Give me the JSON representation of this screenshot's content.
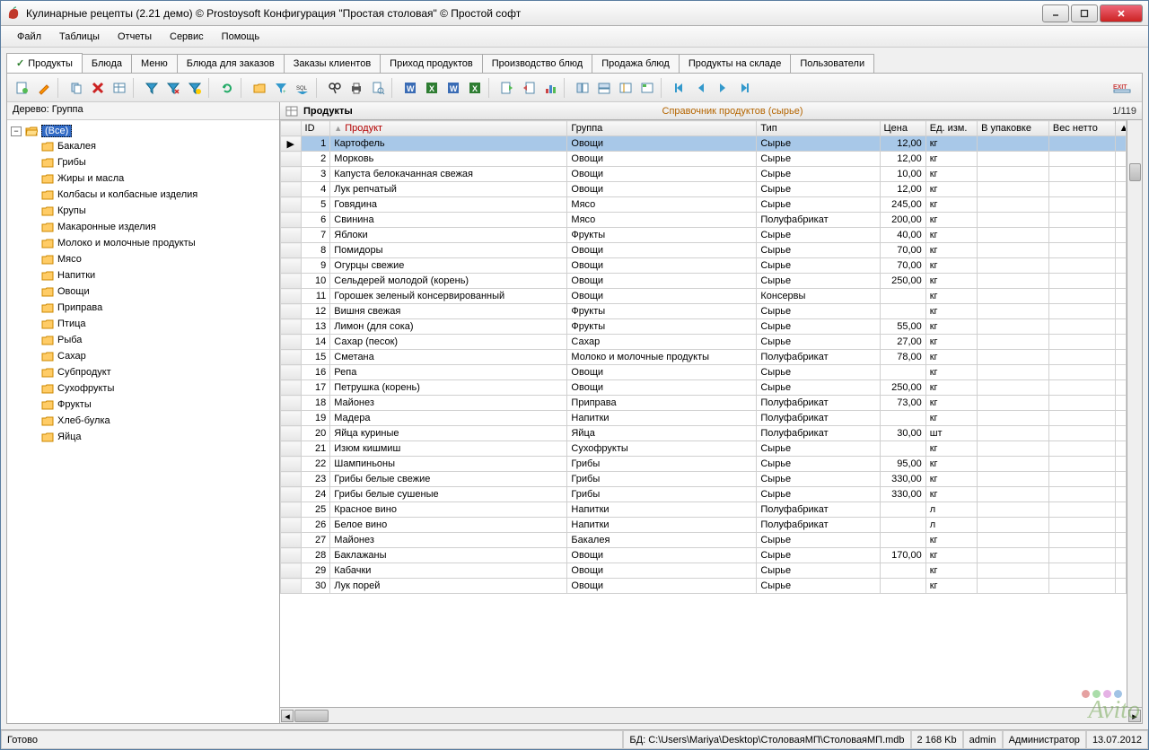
{
  "titlebar": "Кулинарные рецепты (2.21 демо) © Prostoysoft   Конфигурация \"Простая столовая\" © Простой софт",
  "menu": [
    "Файл",
    "Таблицы",
    "Отчеты",
    "Сервис",
    "Помощь"
  ],
  "tabs": [
    "Продукты",
    "Блюда",
    "Меню",
    "Блюда для заказов",
    "Заказы клиентов",
    "Приход продуктов",
    "Производство блюд",
    "Продажа блюд",
    "Продукты на складе",
    "Пользователи"
  ],
  "tree": {
    "header": "Дерево: Группа",
    "root": "(Все)",
    "items": [
      "Бакалея",
      "Грибы",
      "Жиры и масла",
      "Колбасы и колбасные изделия",
      "Крупы",
      "Макаронные изделия",
      "Молоко и молочные продукты",
      "Мясо",
      "Напитки",
      "Овощи",
      "Приправа",
      "Птица",
      "Рыба",
      "Сахар",
      "Субпродукт",
      "Сухофрукты",
      "Фрукты",
      "Хлеб-булка",
      "Яйца"
    ]
  },
  "gridheader": {
    "title": "Продукты",
    "subtitle": "Справочник продуктов (сырье)",
    "count": "1/119"
  },
  "columns": [
    "ID",
    "Продукт",
    "Группа",
    "Тип",
    "Цена",
    "Ед. изм.",
    "В упаковке",
    "Вес нетто"
  ],
  "rows": [
    {
      "id": 1,
      "prod": "Картофель",
      "group": "Овощи",
      "type": "Сырье",
      "price": "12,00",
      "unit": "кг"
    },
    {
      "id": 2,
      "prod": "Морковь",
      "group": "Овощи",
      "type": "Сырье",
      "price": "12,00",
      "unit": "кг"
    },
    {
      "id": 3,
      "prod": "Капуста белокачанная свежая",
      "group": "Овощи",
      "type": "Сырье",
      "price": "10,00",
      "unit": "кг"
    },
    {
      "id": 4,
      "prod": "Лук репчатый",
      "group": "Овощи",
      "type": "Сырье",
      "price": "12,00",
      "unit": "кг"
    },
    {
      "id": 5,
      "prod": "Говядина",
      "group": "Мясо",
      "type": "Сырье",
      "price": "245,00",
      "unit": "кг"
    },
    {
      "id": 6,
      "prod": "Свинина",
      "group": "Мясо",
      "type": "Полуфабрикат",
      "price": "200,00",
      "unit": "кг"
    },
    {
      "id": 7,
      "prod": "Яблоки",
      "group": "Фрукты",
      "type": "Сырье",
      "price": "40,00",
      "unit": "кг"
    },
    {
      "id": 8,
      "prod": "Помидоры",
      "group": "Овощи",
      "type": "Сырье",
      "price": "70,00",
      "unit": "кг"
    },
    {
      "id": 9,
      "prod": "Огурцы свежие",
      "group": "Овощи",
      "type": "Сырье",
      "price": "70,00",
      "unit": "кг"
    },
    {
      "id": 10,
      "prod": "Сельдерей молодой (корень)",
      "group": "Овощи",
      "type": "Сырье",
      "price": "250,00",
      "unit": "кг"
    },
    {
      "id": 11,
      "prod": "Горошек зеленый консервированный",
      "group": "Овощи",
      "type": "Консервы",
      "price": "",
      "unit": "кг"
    },
    {
      "id": 12,
      "prod": "Вишня свежая",
      "group": "Фрукты",
      "type": "Сырье",
      "price": "",
      "unit": "кг"
    },
    {
      "id": 13,
      "prod": "Лимон (для сока)",
      "group": "Фрукты",
      "type": "Сырье",
      "price": "55,00",
      "unit": "кг"
    },
    {
      "id": 14,
      "prod": "Сахар (песок)",
      "group": "Сахар",
      "type": "Сырье",
      "price": "27,00",
      "unit": "кг"
    },
    {
      "id": 15,
      "prod": "Сметана",
      "group": "Молоко и молочные продукты",
      "type": "Полуфабрикат",
      "price": "78,00",
      "unit": "кг"
    },
    {
      "id": 16,
      "prod": "Репа",
      "group": "Овощи",
      "type": "Сырье",
      "price": "",
      "unit": "кг"
    },
    {
      "id": 17,
      "prod": "Петрушка (корень)",
      "group": "Овощи",
      "type": "Сырье",
      "price": "250,00",
      "unit": "кг"
    },
    {
      "id": 18,
      "prod": "Майонез",
      "group": "Приправа",
      "type": "Полуфабрикат",
      "price": "73,00",
      "unit": "кг"
    },
    {
      "id": 19,
      "prod": "Мадера",
      "group": "Напитки",
      "type": "Полуфабрикат",
      "price": "",
      "unit": "кг"
    },
    {
      "id": 20,
      "prod": "Яйца куриные",
      "group": "Яйца",
      "type": "Полуфабрикат",
      "price": "30,00",
      "unit": "шт"
    },
    {
      "id": 21,
      "prod": "Изюм кишмиш",
      "group": "Сухофрукты",
      "type": "Сырье",
      "price": "",
      "unit": "кг"
    },
    {
      "id": 22,
      "prod": "Шампиньоны",
      "group": "Грибы",
      "type": "Сырье",
      "price": "95,00",
      "unit": "кг"
    },
    {
      "id": 23,
      "prod": "Грибы белые свежие",
      "group": "Грибы",
      "type": "Сырье",
      "price": "330,00",
      "unit": "кг"
    },
    {
      "id": 24,
      "prod": "Грибы белые сушеные",
      "group": "Грибы",
      "type": "Сырье",
      "price": "330,00",
      "unit": "кг"
    },
    {
      "id": 25,
      "prod": "Красное вино",
      "group": "Напитки",
      "type": "Полуфабрикат",
      "price": "",
      "unit": "л"
    },
    {
      "id": 26,
      "prod": "Белое вино",
      "group": "Напитки",
      "type": "Полуфабрикат",
      "price": "",
      "unit": "л"
    },
    {
      "id": 27,
      "prod": "Майонез",
      "group": "Бакалея",
      "type": "Сырье",
      "price": "",
      "unit": "кг"
    },
    {
      "id": 28,
      "prod": "Баклажаны",
      "group": "Овощи",
      "type": "Сырье",
      "price": "170,00",
      "unit": "кг"
    },
    {
      "id": 29,
      "prod": "Кабачки",
      "group": "Овощи",
      "type": "Сырье",
      "price": "",
      "unit": "кг"
    },
    {
      "id": 30,
      "prod": "Лук порей",
      "group": "Овощи",
      "type": "Сырье",
      "price": "",
      "unit": "кг"
    }
  ],
  "status": {
    "ready": "Готово",
    "bd_label": "БД:",
    "bd": "C:\\Users\\Mariya\\Desktop\\СтоловаяМП\\СтоловаяМП.mdb",
    "size": "2 168 Kb",
    "user": "admin",
    "login": "Администратор",
    "date": "13.07.2012"
  },
  "watermark": "Avito"
}
